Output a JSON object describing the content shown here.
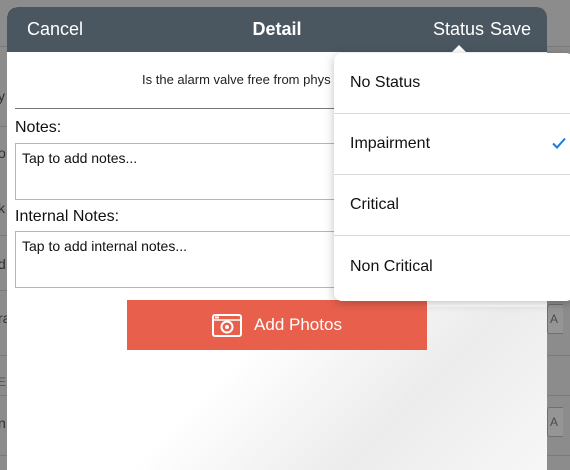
{
  "background": {
    "fragments": [
      "y",
      "o",
      "k",
      "d",
      "ra",
      "E",
      "n"
    ],
    "side_button": "A"
  },
  "navbar": {
    "cancel_label": "Cancel",
    "title": "Detail",
    "status_label": "Status",
    "save_label": "Save"
  },
  "form": {
    "question": "Is the alarm valve free from phys",
    "notes_label": "Notes:",
    "notes_placeholder": "Tap to add notes...",
    "internal_notes_label": "Internal Notes:",
    "internal_notes_placeholder": "Tap to add internal notes...",
    "add_photos_label": "Add Photos"
  },
  "status_menu": {
    "items": [
      {
        "label": "No Status",
        "selected": false
      },
      {
        "label": "Impairment",
        "selected": true
      },
      {
        "label": "Critical",
        "selected": false
      },
      {
        "label": "Non Critical",
        "selected": false
      }
    ]
  },
  "colors": {
    "navbar": "#4a5760",
    "accent_button": "#e8604c",
    "checkmark": "#1a7ce0"
  }
}
